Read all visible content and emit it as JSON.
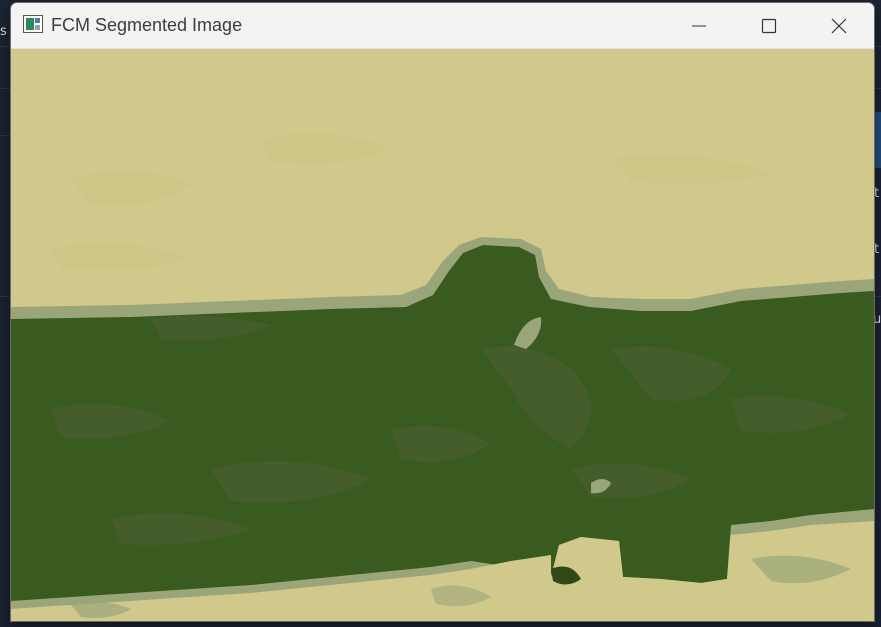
{
  "window": {
    "title": "FCM Segmented Image",
    "icon": "image-window-icon",
    "controls": [
      "minimize-icon",
      "maximize-icon",
      "close-icon"
    ]
  },
  "image": {
    "description_kind": "segmented-landscape",
    "segment_colors": {
      "sky_sand": "#d1c88b",
      "transition": "#9ba57a",
      "mid_green": "#445d2b",
      "dark_green": "#3a5b1f"
    }
  },
  "background": {
    "glyphs": [
      "s",
      "t",
      "t",
      "u"
    ]
  }
}
